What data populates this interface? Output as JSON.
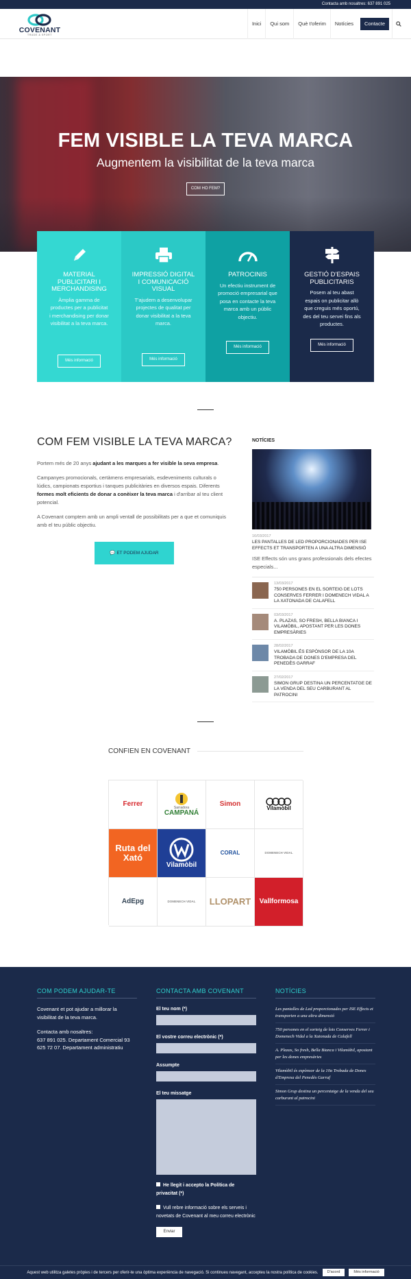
{
  "topbar": {
    "contact": "Contacta amb nosaltres: 637 891 025"
  },
  "header": {
    "logo_name": "COVENANT",
    "logo_tagline": "TRADE & SPORT",
    "nav": [
      "Inici",
      "Qui som",
      "Què t'oferim",
      "Notícies"
    ],
    "nav_cta": "Contacte",
    "search_icon": "search-icon"
  },
  "hero": {
    "title": "FEM VISIBLE LA TEVA MARCA",
    "subtitle": "Augmentem la visibilitat de la teva marca",
    "button": "COM HO FEM?"
  },
  "services": [
    {
      "icon": "pencil-icon",
      "color": "#34d8d2",
      "title": "MATERIAL PUBLICITARI I MERCHANDISING",
      "text": "Àmplia gamma de productes per a publicitat i merchandising per donar visibilitat a la teva marca.",
      "button": "Més informació"
    },
    {
      "icon": "printer-icon",
      "color": "#2bc9c6",
      "title": "IMPRESSIÓ DIGITAL I COMUNICACIÓ VISUAL",
      "text": "T'ajudem a desenvolupar projectes de qualitat per donar visibilitat a la teva marca.",
      "button": "Més informació"
    },
    {
      "icon": "gauge-icon",
      "color": "#0fa1a3",
      "title": "PATROCINIS",
      "text": "Un efectiu instrument de promoció empresarial que posa en contacte la teva marca amb un públic objectiu.",
      "button": "Més informació"
    },
    {
      "icon": "signpost-icon",
      "color": "#1b2a4a",
      "title": "GESTIÓ D'ESPAIS PUBLICITARIS",
      "text": "Posem al teu abast espais on publicitar allò que creguis més oportú, des del teu servei fins als productes.",
      "button": "Més informació"
    }
  ],
  "intro": {
    "title": "COM FEM VISIBLE LA TEVA MARCA?",
    "p1_start": "Portem més de 20 anys ",
    "p1_bold": "ajudant a les marques a fer visible la seva empresa",
    "p1_end": ".",
    "p2_start": "Campanyes promocionals, certàmens empresarials, esdeveniments culturals o lúdics, campionats esportius i tanques publicitàries en diversos espais. Diferents ",
    "p2_bold": "formes molt eficients de donar a conèixer la teva marca",
    "p2_end": " i d'arribar al teu client potencial.",
    "p3": "A Covenant comptem amb un ampli ventall de possibilitats per a que et comuniquis amb el teu públic objectiu.",
    "button": "ET PODEM AJUDAR"
  },
  "news": {
    "heading": "NOTÍCIES",
    "featured": {
      "date": "16/03/2017",
      "title": "LES PANTALLES DE LED PROPORCIONADES PER ISE EFFECTS ET TRANSPORTEN A UNA ALTRA DIMENSIÓ",
      "excerpt": "ISE Effects són uns grans professionals dels efectes especials..."
    },
    "items": [
      {
        "date": "13/03/2017",
        "title": "750 PERSONES EN EL SORTEIG DE LOTS CONSERVES FERRER I DOMENECH VIDAL A LA XATONADA DE CALAFELL",
        "color": "#8a6650"
      },
      {
        "date": "03/03/2017",
        "title": "A. PLAZAS, SO FRESH, BELLA BIANCA I VILAMÒBIL, APOSTANT PER LES DONES EMPRESÀRIES",
        "color": "#a58a7a"
      },
      {
        "date": "28/02/2017",
        "title": "VILAMÒBIL ÉS ESPÒNSOR DE LA 10A TROBADA DE DONES D'EMPRESA DEL PENEDÈS GARRAF",
        "color": "#6d88a8"
      },
      {
        "date": "27/02/2017",
        "title": "SIMON GRUP DESTINA UN PERCENTATGE DE LA VENDA DEL SEU CARBURANT AL PATROCINI",
        "color": "#8c9a93"
      }
    ]
  },
  "clients": {
    "title": "CONFIEN EN COVENANT",
    "logos": [
      {
        "name": "Ferrer",
        "sub": "",
        "color": "#d6252a"
      },
      {
        "name": "CAMPANÁ",
        "sub": "Sarradora",
        "color": "#2e7d32"
      },
      {
        "name": "Simon",
        "sub": "",
        "color": "#d32f2f"
      },
      {
        "name": "Vilamòbil",
        "sub": "",
        "color": "#111111"
      },
      {
        "name": "Ruta del Xató",
        "sub": "",
        "color": "#f26522"
      },
      {
        "name": "Vilamòbil",
        "sub": "",
        "color": "#1f3f96"
      },
      {
        "name": "CORAL",
        "sub": "",
        "color": "#1d4f9c"
      },
      {
        "name": "DOMENECH VIDAL",
        "sub": "",
        "color": "#8a8a8a"
      },
      {
        "name": "AdEpg",
        "sub": "",
        "color": "#345"
      },
      {
        "name": "DOMENECH VIDAL",
        "sub": "",
        "color": "#8a8a8a"
      },
      {
        "name": "LLOPART",
        "sub": "",
        "color": "#b0916a"
      },
      {
        "name": "Vallformosa",
        "sub": "",
        "color": "#d21f2a"
      }
    ]
  },
  "footer": {
    "help": {
      "heading": "COM PODEM AJUDAR-TE",
      "text": "Covenant et pot ajudar a millorar la visibilitat de la teva marca.",
      "contact_label": "Contacta amb nosaltres:",
      "contact_text": "637 891 025. Departament Comercial 93 625 72 07. Departament administratiu"
    },
    "form": {
      "heading": "CONTACTA AMB COVENANT",
      "name_label": "El teu nom (*)",
      "email_label": "El vostre correu electrònic (*)",
      "subject_label": "Assumpte",
      "message_label": "El teu missatge",
      "privacy_label": "He llegit i accepto la Política de privacitat (*)",
      "newsletter_label": "Vull rebre informació sobre els serveis i novetats de Covenant al meu correu electrònic",
      "submit": "Enviar"
    },
    "news": {
      "heading": "NOTÍCIES",
      "items": [
        "Les pantalles de Led proporcionades per ISE Effects et transporten a una altra dimensió",
        "750 persones en el sorteig de lots Conserves Ferrer i Domenech Vidal a la Xatonada de Calafell",
        "A. Plazas, So fresh, Bella Bianca i Vilamòbil, apostant per les dones empresàries",
        "Vilamòbil és espònsor de la 10a Trobada de Dones d'Empresa del Penedès Garraf",
        "Simon Grup destina un percentatge de la venda del seu carburant al patrocini"
      ]
    }
  },
  "cookie": {
    "text": "Aquest web utilitza galetes pròpies i de tercers per oferir-te una òptima experiència de navegació. Si continueu navegant, accepteu la nostra política de cookies.",
    "accept": "D'acord",
    "more": "Més informació"
  }
}
